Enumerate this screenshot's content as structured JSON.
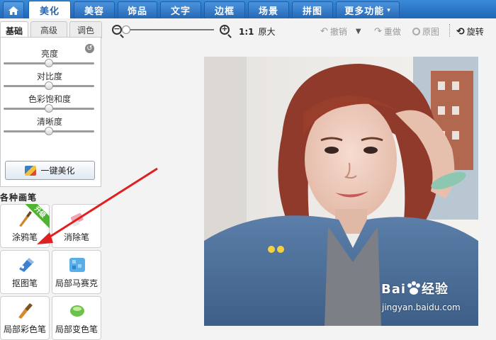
{
  "nav": {
    "tabs": [
      {
        "label": "美化",
        "active": true
      },
      {
        "label": "美容"
      },
      {
        "label": "饰品"
      },
      {
        "label": "文字"
      },
      {
        "label": "边框"
      },
      {
        "label": "场景"
      },
      {
        "label": "拼图"
      },
      {
        "label": "更多功能"
      }
    ],
    "more_caret": "▾"
  },
  "left": {
    "subtabs": [
      "基础",
      "高级",
      "调色"
    ],
    "sliders": [
      {
        "label": "亮度",
        "value": 0.5
      },
      {
        "label": "对比度",
        "value": 0.5
      },
      {
        "label": "色彩饱和度",
        "value": 0.5
      },
      {
        "label": "清晰度",
        "value": 0.5
      }
    ],
    "onekey_label": "一键美化",
    "section_title": "各种画笔",
    "brushes": [
      {
        "label": "涂鸦笔",
        "badge": "升级"
      },
      {
        "label": "消除笔"
      },
      {
        "label": "抠图笔"
      },
      {
        "label": "局部马赛克"
      },
      {
        "label": "局部彩色笔"
      },
      {
        "label": "局部变色笔"
      }
    ]
  },
  "toolbar": {
    "zoom_out": "−",
    "zoom_in": "+",
    "zoom_value": 0.0,
    "ratio": "1:1",
    "original_size": "原大",
    "undo": "撤销",
    "redo": "重做",
    "original": "原图",
    "rotate": "旋转"
  },
  "watermark": {
    "logo": "Bai",
    "logo_suffix": "经验",
    "url": "jingyan.baidu.com"
  },
  "colors": {
    "nav_blue": "#1f67b6",
    "annotation_red": "#e02020",
    "upgrade_green": "#4eb332"
  }
}
